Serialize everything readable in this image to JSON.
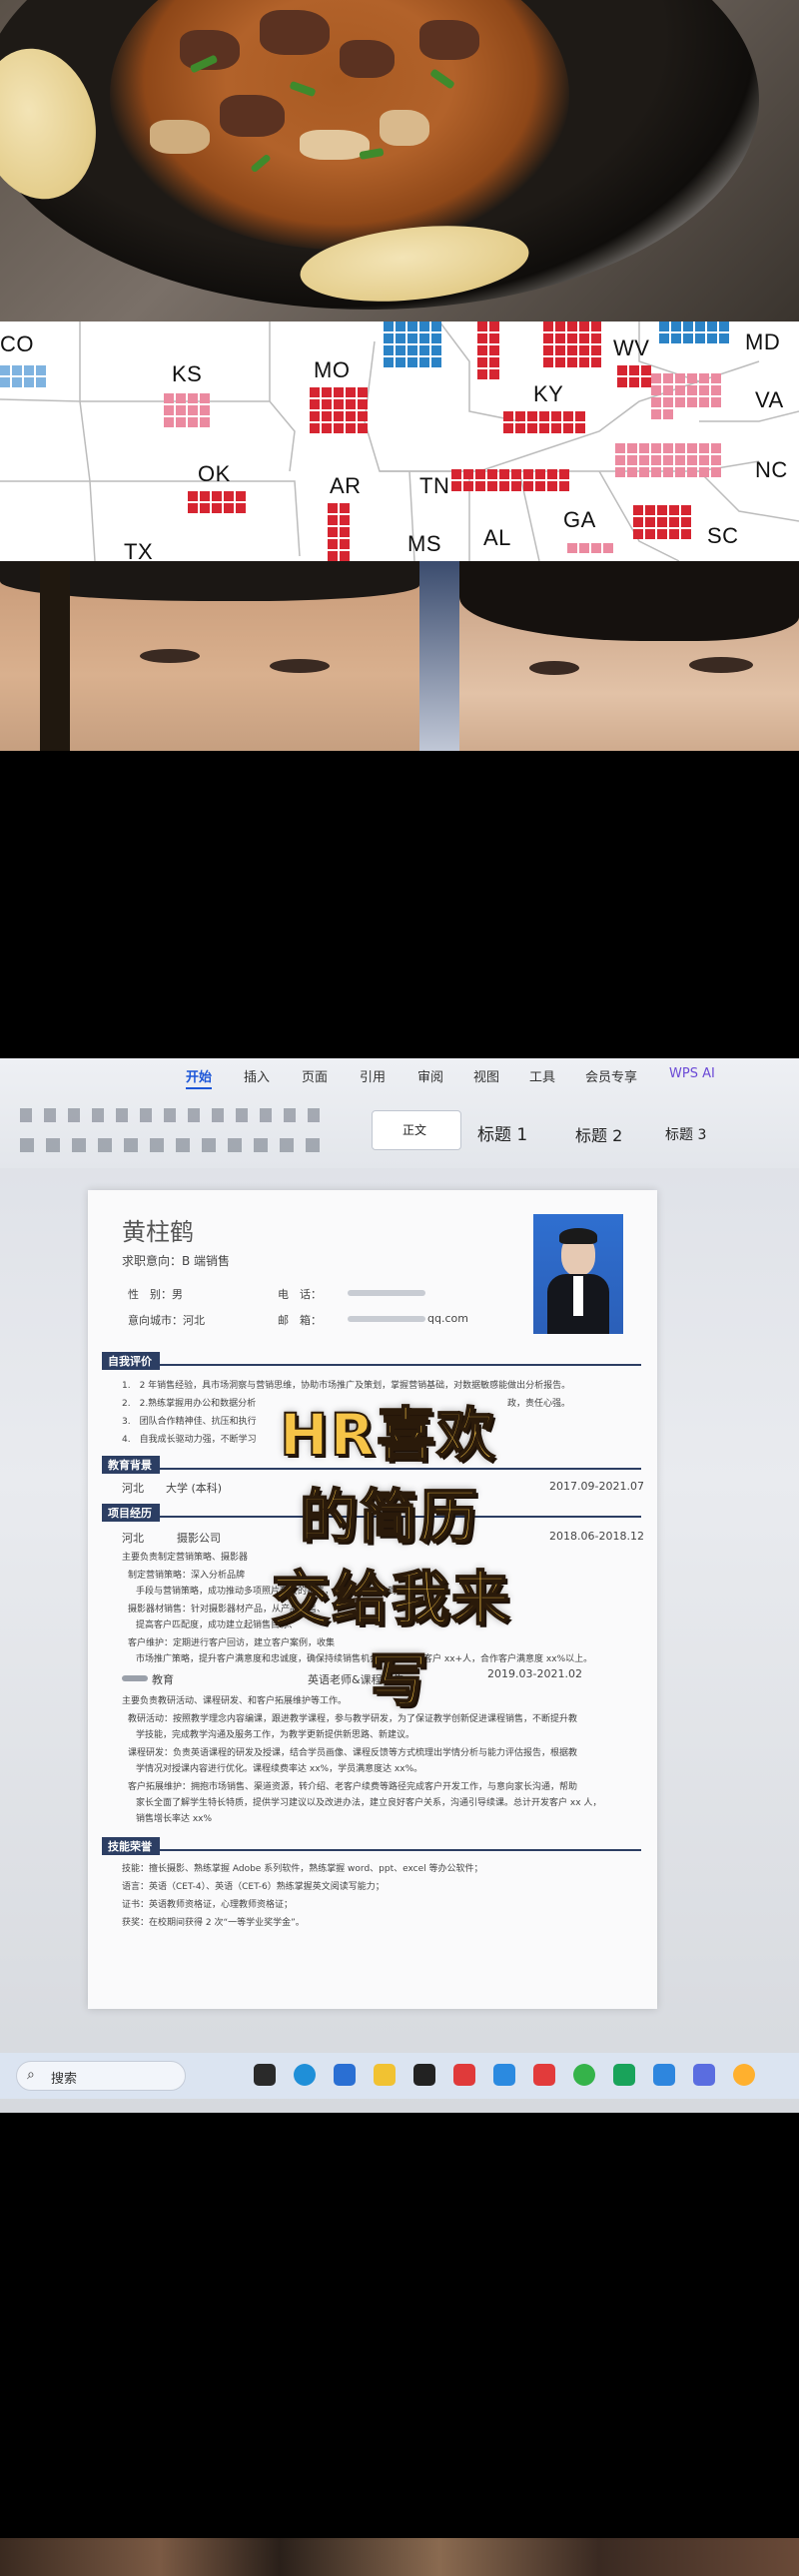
{
  "map": {
    "labels": [
      "CO",
      "KS",
      "MO",
      "WV",
      "MD",
      "KY",
      "VA",
      "OK",
      "AR",
      "TN",
      "NC",
      "TX",
      "MS",
      "AL",
      "GA",
      "SC"
    ],
    "colors": {
      "red": "#d62531",
      "blue": "#2b83c6",
      "light_blue": "#7fb3e0",
      "pink": "#eb8aa0"
    }
  },
  "word": {
    "tabs": [
      "开始",
      "插入",
      "页面",
      "引用",
      "审阅",
      "视图",
      "工具",
      "会员专享"
    ],
    "active_tab": "开始",
    "wps_ai": "WPS AI",
    "styles": [
      "正文",
      "标题 1",
      "标题 2",
      "标题 3"
    ],
    "resume": {
      "name": "黄柱鹤",
      "intent": "求职意向：B 端销售",
      "gender_label": "性　别：男",
      "phone_label": "电　话：",
      "city_label": "意向城市：河北",
      "email_label": "邮　箱：",
      "email_suffix": "qq.com",
      "sections": {
        "eval": "自我评价",
        "edu": "教育背景",
        "proj": "项目经历",
        "skills": "技能荣誉"
      },
      "eval_items": [
        "1.　2 年销售经验，具市场洞察与营销思维，协助市场推广及策划，掌握营销基础，对数据敏感能做出分析报告。",
        "2.　2.熟练掌握用办公和数据分析",
        "3.　团队合作精神佳、抗压和执行",
        "4.　自我成长驱动力强，不断学习"
      ],
      "eval_tail": [
        "政，责任心强。"
      ],
      "edu": {
        "school": "河北　　大学 (本科)",
        "dates": "2017.09-2021.07"
      },
      "job1": {
        "company": "河北　　　摄影公司",
        "dates": "2018.06-2018.12",
        "role": "主要负责制定营销策略、摄影器",
        "bullets": [
          "制定营销策略：深入分析品牌",
          "手段与营销策略，成功推动多项照片套餐的销售，服务满意度达到 100%。",
          "摄影器材销售：针对摄影器材产品，从产品销售、",
          "提高客户匹配度，成功建立起销售目标、",
          "客户维护：定期进行客户回访，建立客户案例，收集",
          "市场推广策略，提升客户满意度和忠诚度，确保持续销售机会。总计维护客户 xx+人，合作客户满意度 xx%以上。"
        ]
      },
      "job2": {
        "company": "教育",
        "role": "英语老师&课程销售",
        "dates": "2019.03-2021.02",
        "summary": "主要负责教研活动、课程研发、和客户拓展维护等工作。",
        "bullets": [
          "教研活动：按照教学理念内容编课，跟进教学课程，参与教学研发，为了保证教学创新促进课程销售，不断提升教",
          "学技能，完成教学沟通及服务工作，为教学更新提供新思路、新建议。",
          "课程研发：负责英语课程的研发及授课，结合学员画像、课程反馈等方式梳理出学情分析与能力评估报告，根据教",
          "学情况对授课内容进行优化。课程续费率达 xx%，学员满意度达 xx%。",
          "客户拓展维护：拥抱市场销售、渠道资源，转介绍、老客户续费等路径完成客户开发工作，与意向家长沟通，帮助",
          "家长全面了解学生特长特质，提供学习建议以及改进办法，建立良好客户关系，沟通引导续课。总计开发客户 xx 人，",
          "销售增长率达 xx%"
        ]
      },
      "skills": [
        "技能：擅长摄影、熟练掌握 Adobe 系列软件，熟练掌握 word、ppt、excel 等办公软件；",
        "语言：英语（CET-4）、英语（CET-6）熟练掌握英文阅读写能力；",
        "证书：英语教师资格证，心理教师资格证；",
        "获奖：在校期间获得 2 次“一等学业奖学金”。"
      ]
    },
    "taskbar_search": "搜索",
    "overlay_text": [
      "HR喜欢",
      "的简历",
      "交给我来",
      "写"
    ]
  }
}
